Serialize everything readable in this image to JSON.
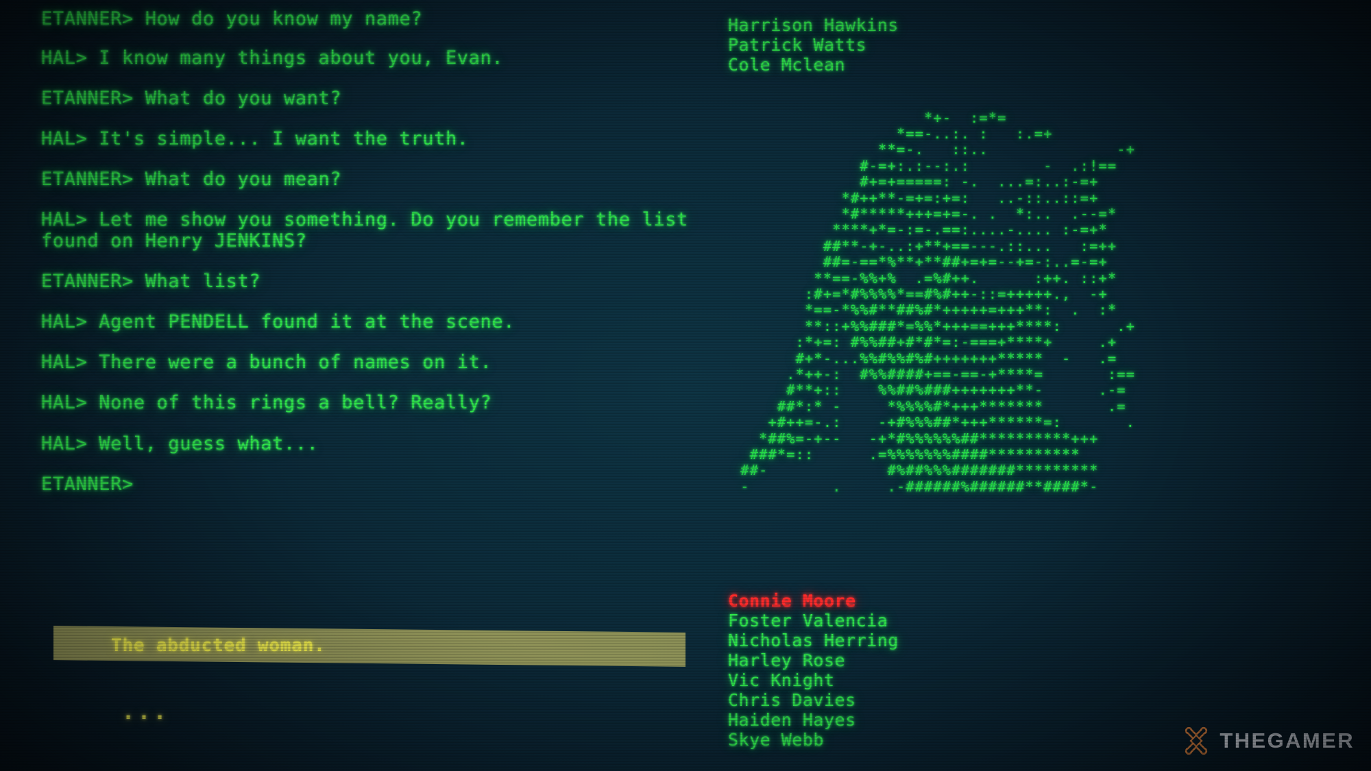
{
  "colors": {
    "terminal_green": "#2fe34a",
    "highlight_red": "#ff2b2b",
    "choice_bar": "#9fa05e",
    "choice_text": "#f2ef4e",
    "background": "#0c2c3b"
  },
  "dialogue": {
    "lines": [
      {
        "speaker": "ETANNER>",
        "text": "ETANNER> How do you know my name?"
      },
      {
        "speaker": "HAL>",
        "text": "HAL> I know many things about you, Evan."
      },
      {
        "speaker": "ETANNER>",
        "text": "ETANNER> What do you want?"
      },
      {
        "speaker": "HAL>",
        "text": "HAL> It's simple... I want the truth."
      },
      {
        "speaker": "ETANNER>",
        "text": "ETANNER> What do you mean?"
      },
      {
        "speaker": "HAL>",
        "text": "HAL> Let me show you something. Do you remember the list"
      },
      {
        "speaker": "",
        "text": "found on Henry JENKINS?"
      },
      {
        "speaker": "ETANNER>",
        "text": "ETANNER> What list?"
      },
      {
        "speaker": "HAL>",
        "text": "HAL> Agent PENDELL found it at the scene."
      },
      {
        "speaker": "HAL>",
        "text": "HAL> There were a bunch of names on it."
      },
      {
        "speaker": "HAL>",
        "text": "HAL> None of this rings a bell? Really?"
      },
      {
        "speaker": "HAL>",
        "text": "HAL> Well, guess what..."
      },
      {
        "speaker": "ETANNER>",
        "text": "ETANNER>"
      }
    ]
  },
  "choices": {
    "selected_index": 0,
    "options": [
      {
        "label": "The abducted woman.",
        "selected": true
      }
    ],
    "continue_indicator": "..."
  },
  "names_top": {
    "items": [
      {
        "label": "Harrison Hawkins",
        "highlight": false
      },
      {
        "label": "Patrick Watts",
        "highlight": false
      },
      {
        "label": "Cole Mclean",
        "highlight": false
      }
    ]
  },
  "names_bottom": {
    "items": [
      {
        "label": "Connie Moore",
        "highlight": true
      },
      {
        "label": "Foster Valencia",
        "highlight": false
      },
      {
        "label": "Nicholas Herring",
        "highlight": false
      },
      {
        "label": "Harley Rose",
        "highlight": false
      },
      {
        "label": "Vic Knight",
        "highlight": false
      },
      {
        "label": "Chris Davies",
        "highlight": false
      },
      {
        "label": "Haiden Hayes",
        "highlight": false
      },
      {
        "label": "Skye Webb",
        "highlight": false
      }
    ]
  },
  "ascii_portrait": {
    "description": "hooded-figure-ascii-portrait",
    "rows": [
      "                       *+-  :=*=",
      "                    *==-..:. :   :.=+",
      "                  **=-.   ::..              -+",
      "                #-=+:.:--:.:        -  .:!==",
      "                #+=+=====: -.  ...=:..:-=+",
      "              *#++**-=+=:+=:   ..-::..::=+",
      "              *#*****+++=+=-. .  *:..  .--=*",
      "             ****+*=-:=-.==:....-.... :-=+*",
      "            ##**-+-..:+**+==---.::...   :=++",
      "            ##=-==*%**+**##+=+=--+=-:..=-=+",
      "           **==-%%+%  .=%#++.      :++. ::+*",
      "          :#+=*#%%%%*==#%#++-::=+++++.,  -+",
      "          *==-*%%#**##%#*+++++=+++**:  .  :*",
      "          **::+%%###*=%%*+++==+++****:      .+",
      "         :*+=: #%%##+#*#*=:-===+****+     .+",
      "         #+*-...%%#%%#%#+++++++*****  -   .=",
      "        .*++-:  #%%####+==-==-+****=       :==",
      "        #**+::    %%##%###+++++++**-      .-=",
      "       ##*:* -     *%%%%#*+++*******       .=",
      "      +#++=-.:    -+#%%%##*+++******=:       .",
      "     *##%=-+--   -+*#%%%%%%##**********+++",
      "    ###*=::      .=%%%%%%%####**********",
      "   ##-             #%##%%%#######*********",
      "   -         .     .-######%######**####*-"
    ]
  },
  "watermark": {
    "text": "THEGAMER"
  }
}
